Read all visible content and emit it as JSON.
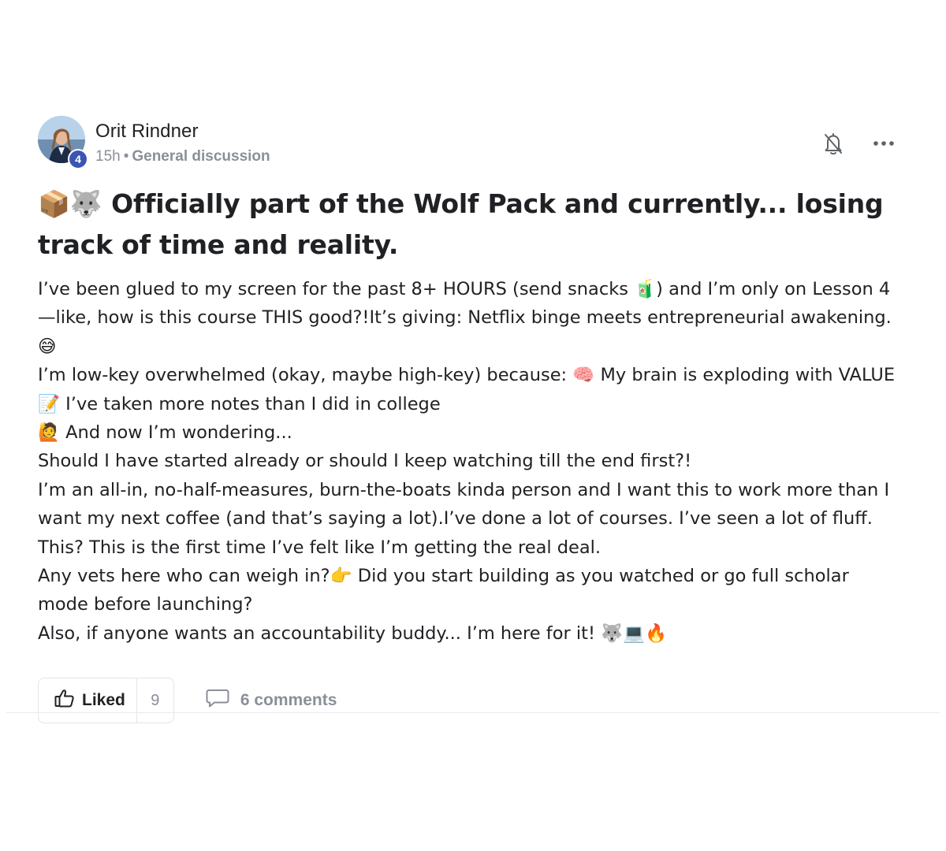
{
  "post": {
    "author": "Orit Rindner",
    "level": "4",
    "time": "15h",
    "separator": "•",
    "category": "General discussion",
    "title": "📦🐺 Officially part of the Wolf Pack and currently... losing track of time and reality.",
    "body": [
      "I’ve been glued to my screen for the past 8+ HOURS (send snacks 🧃) and I’m only on Lesson 4—like, how is this course THIS good?!It’s giving: Netflix binge meets entrepreneurial awakening. 😅",
      "I’m low-key overwhelmed (okay, maybe high-key) because: 🧠 My brain is exploding with VALUE",
      "📝 I’ve taken more notes than I did in college",
      "🙋 And now I’m wondering...",
      "Should I have started already or should I keep watching till the end first?!",
      "I’m an all-in, no-half-measures, burn-the-boats kinda person and I want this to work more than I want my next coffee (and that’s saying a lot).I’ve done a lot of courses. I’ve seen a lot of fluff. This? This is the first time I’ve felt like I’m getting the real deal.",
      "Any vets here who can weigh in?👉 Did you start building as you watched or go full scholar mode before launching?",
      "Also, if anyone wants an accountability buddy... I’m here for it! 🐺💻🔥"
    ],
    "like_label": "Liked",
    "like_count": "9",
    "comments_label": "6 comments"
  },
  "icons": {
    "bell": "bell-off-icon",
    "more": "more-horizontal-icon",
    "like": "thumbs-up-icon",
    "comment": "comment-bubble-icon"
  }
}
